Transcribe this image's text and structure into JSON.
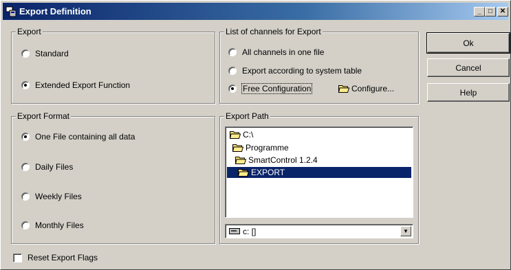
{
  "window": {
    "title": "Export Definition",
    "minimize": "_",
    "maximize": "□",
    "close": "✕"
  },
  "export_group": {
    "legend": "Export",
    "options": [
      {
        "label": "Standard",
        "checked": false
      },
      {
        "label": "Extended Export Function",
        "checked": true
      }
    ]
  },
  "channels_group": {
    "legend": "List of channels for Export",
    "options": [
      {
        "label": "All channels in one file",
        "checked": false
      },
      {
        "label": "Export according to system table",
        "checked": false
      },
      {
        "label": "Free Configuration",
        "checked": true
      }
    ],
    "configure_label": "Configure..."
  },
  "format_group": {
    "legend": "Export Format",
    "options": [
      {
        "label": "One File containing all data",
        "checked": true
      },
      {
        "label": "Daily Files",
        "checked": false
      },
      {
        "label": "Weekly Files",
        "checked": false
      },
      {
        "label": "Monthly Files",
        "checked": false
      }
    ]
  },
  "path_group": {
    "legend": "Export Path",
    "tree": [
      {
        "label": "C:\\",
        "selected": false
      },
      {
        "label": "Programme",
        "selected": false
      },
      {
        "label": "SmartControl 1.2.4",
        "selected": false
      },
      {
        "label": "EXPORT",
        "selected": true
      }
    ],
    "drive": "c: []"
  },
  "buttons": {
    "ok": "Ok",
    "cancel": "Cancel",
    "help": "Help"
  },
  "reset_checkbox": {
    "label": "Reset Export Flags",
    "checked": false
  },
  "colors": {
    "face": "#d4d0c8",
    "title_start": "#0a246a",
    "title_end": "#a6caf0",
    "selection": "#0a246a"
  }
}
